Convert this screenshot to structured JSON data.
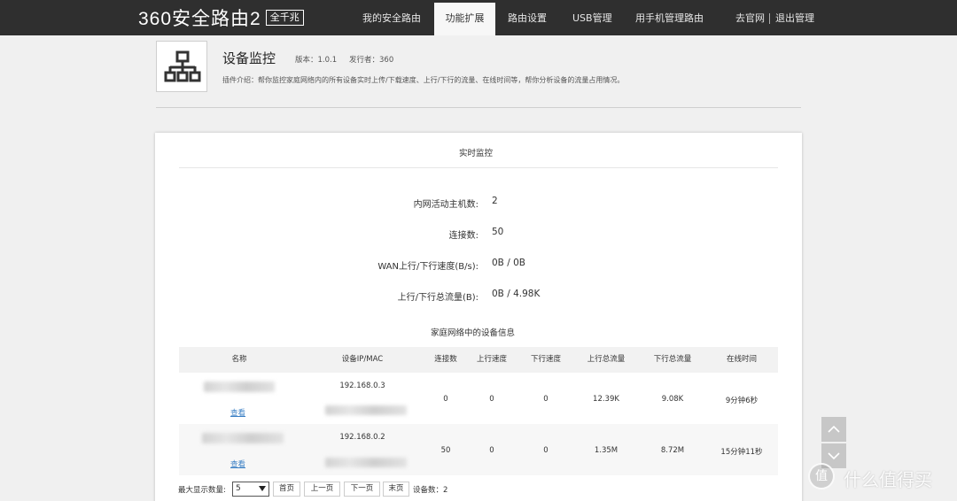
{
  "app": {
    "logo_text": "360安全路由2",
    "logo_badge": "全千兆"
  },
  "nav": {
    "tabs": [
      "我的安全路由",
      "功能扩展",
      "路由设置",
      "USB管理",
      "用手机管理路由"
    ],
    "active_tab": "功能扩展",
    "official_site": "去官网",
    "logout": "退出管理"
  },
  "plugin": {
    "icon": "network-topology-icon",
    "title": "设备监控",
    "version": "版本：1.0.1",
    "publisher": "发行者：360",
    "description": "插件介绍：帮你监控家庭网络内的所有设备实时上传/下载速度、上行/下行的流量、在线时间等，帮你分析设备的流量占用情况。"
  },
  "realtime": {
    "title": "实时监控",
    "stats": [
      {
        "label": "内网活动主机数:",
        "value": "2"
      },
      {
        "label": "连接数:",
        "value": "50"
      },
      {
        "label": "WAN上行/下行速度(B/s):",
        "value": "0B / 0B"
      },
      {
        "label": "上行/下行总流量(B):",
        "value": "0B / 4.98K"
      }
    ]
  },
  "devices": {
    "title": "家庭网络中的设备信息",
    "columns": [
      "名称",
      "设备IP/MAC",
      "连接数",
      "上行速度",
      "下行速度",
      "上行总流量",
      "下行总流量",
      "在线时间"
    ],
    "view_label": "查看",
    "rows": [
      {
        "ip": "192.168.0.3",
        "connections": "0",
        "up_speed": "0",
        "down_speed": "0",
        "up_total": "12.39K",
        "down_total": "9.08K",
        "online": "9分钟6秒"
      },
      {
        "ip": "192.168.0.2",
        "connections": "50",
        "up_speed": "0",
        "down_speed": "0",
        "up_total": "1.35M",
        "down_total": "8.72M",
        "online": "15分钟11秒"
      }
    ]
  },
  "pager": {
    "max_display_label": "最大显示数量:",
    "page_size": "5",
    "first": "首页",
    "prev": "上一页",
    "next": "下一页",
    "last": "末页",
    "device_count": "设备数：2"
  },
  "watermark": {
    "glyph": "值",
    "text": "什么值得买"
  },
  "colors": {
    "topbar": "#2f2f2f",
    "link": "#3a7fc4",
    "page_bg": "#f0f0f0"
  }
}
